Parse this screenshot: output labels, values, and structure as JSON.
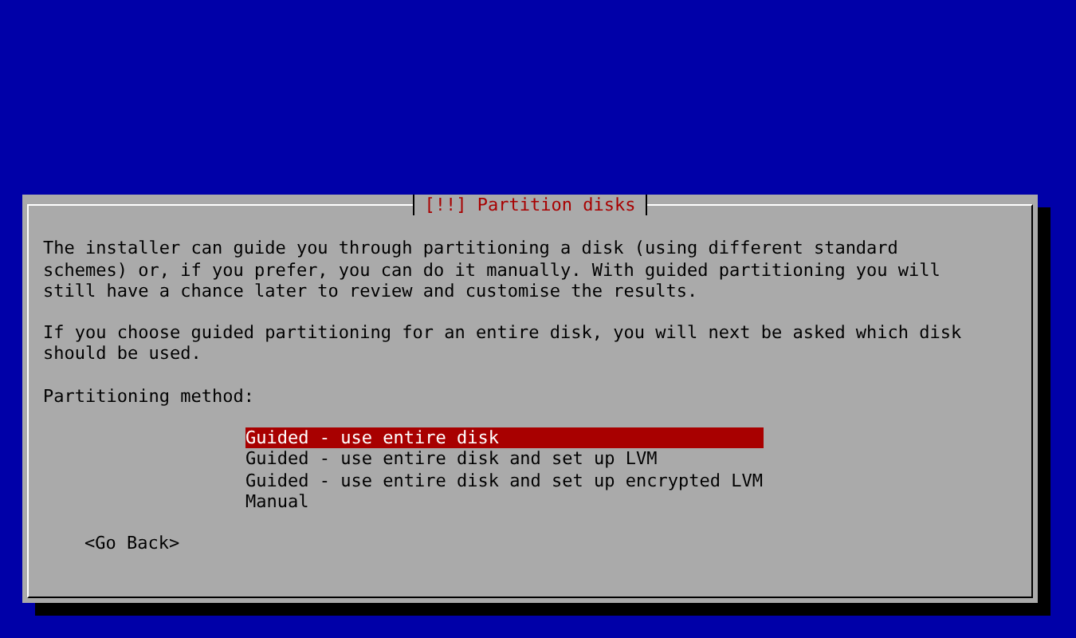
{
  "dialog": {
    "title": "[!!] Partition disks",
    "paragraphs": [
      "The installer can guide you through partitioning a disk (using different standard\nschemes) or, if you prefer, you can do it manually. With guided partitioning you will\nstill have a chance later to review and customise the results.",
      "If you choose guided partitioning for an entire disk, you will next be asked which disk\nshould be used."
    ],
    "prompt": "Partitioning method:",
    "options": [
      {
        "label": "Guided - use entire disk",
        "selected": true
      },
      {
        "label": "Guided - use entire disk and set up LVM",
        "selected": false
      },
      {
        "label": "Guided - use entire disk and set up encrypted LVM",
        "selected": false
      },
      {
        "label": "Manual",
        "selected": false
      }
    ],
    "back_button": "<Go Back>"
  }
}
